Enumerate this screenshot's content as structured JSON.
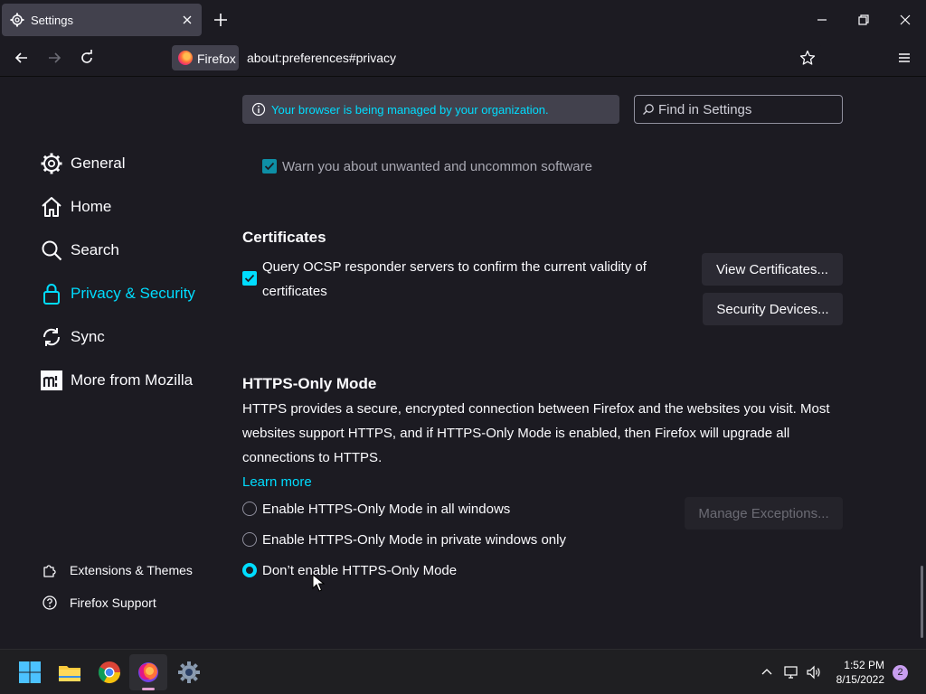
{
  "tab": {
    "title": "Settings"
  },
  "url": {
    "identity": "Firefox",
    "address": "about:preferences#privacy"
  },
  "banner": {
    "text": "Your browser is being managed by your organization."
  },
  "search": {
    "placeholder": "Find in Settings"
  },
  "sidebar": {
    "items": [
      {
        "label": "General",
        "icon": "gear-icon"
      },
      {
        "label": "Home",
        "icon": "home-icon"
      },
      {
        "label": "Search",
        "icon": "search-icon"
      },
      {
        "label": "Privacy & Security",
        "icon": "lock-icon",
        "active": true
      },
      {
        "label": "Sync",
        "icon": "sync-icon"
      },
      {
        "label": "More from Mozilla",
        "icon": "mozilla-icon"
      }
    ],
    "footer": [
      {
        "label": "Extensions & Themes",
        "icon": "puzzle-icon"
      },
      {
        "label": "Firefox Support",
        "icon": "help-icon"
      }
    ]
  },
  "main": {
    "warn_unwanted": "Warn you about unwanted and uncommon software",
    "certificates": {
      "heading": "Certificates",
      "ocsp_line1": "Query OCSP responder servers to confirm the current validity of",
      "ocsp_line2": "certificates",
      "view_button": "View Certificates...",
      "devices_button": "Security Devices..."
    },
    "https": {
      "heading": "HTTPS-Only Mode",
      "desc_line1": "HTTPS provides a secure, encrypted connection between Firefox and the websites you visit. Most",
      "desc_line2": "websites support HTTPS, and if HTTPS-Only Mode is enabled, then Firefox will upgrade all",
      "desc_line3": "connections to HTTPS.",
      "learn_more": "Learn more",
      "options": [
        "Enable HTTPS-Only Mode in all windows",
        "Enable HTTPS-Only Mode in private windows only",
        "Don’t enable HTTPS-Only Mode"
      ],
      "selected_option": "Don’t enable HTTPS-Only Mode",
      "manage_button": "Manage Exceptions..."
    }
  },
  "taskbar": {
    "time": "1:52 PM",
    "date": "8/15/2022",
    "notifications": "2"
  },
  "colors": {
    "accent": "#00ddff",
    "background": "#1c1b22"
  }
}
